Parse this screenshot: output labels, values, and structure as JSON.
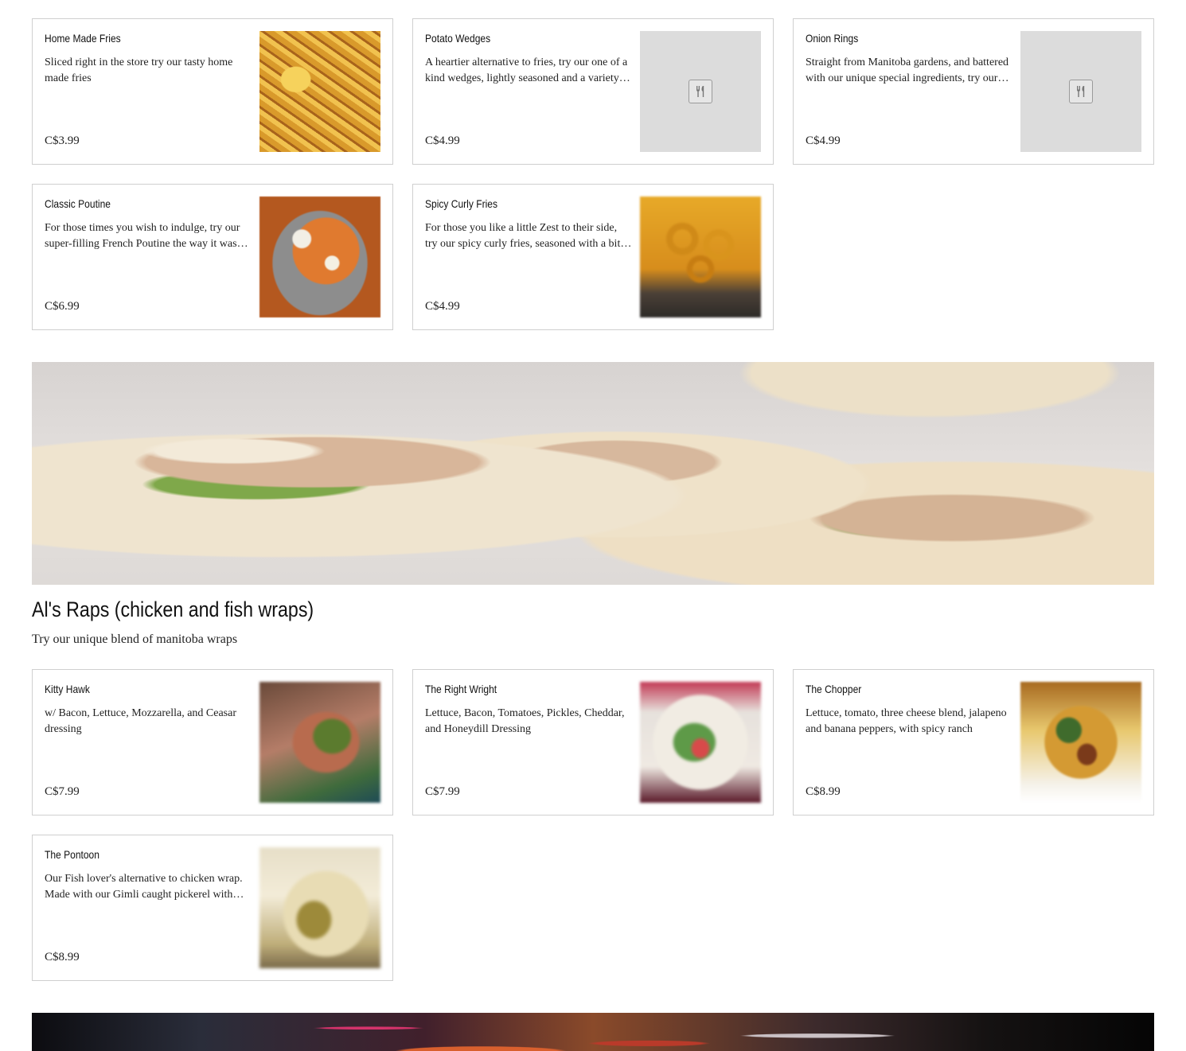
{
  "sides": [
    {
      "name": "Home Made Fries",
      "description": "Sliced right in the store try our tasty home made fries",
      "price": "C$3.99",
      "image": "fries-photo"
    },
    {
      "name": "Potato Wedges",
      "description": "A heartier alternative to fries, try our one of a kind wedges, lightly seasoned and a variety of dipping sauces",
      "price": "C$4.99",
      "image": "placeholder"
    },
    {
      "name": "Onion Rings",
      "description": "Straight from Manitoba gardens, and battered with our unique special ingredients, try our onion rings",
      "price": "C$4.99",
      "image": "placeholder"
    },
    {
      "name": "Classic Poutine",
      "description": "For those times you wish to indulge, try our super-filling French Poutine the way it was meant to be",
      "price": "C$6.99",
      "image": "poutine-photo"
    },
    {
      "name": "Spicy Curly Fries",
      "description": "For those you like a little Zest to their side, try our spicy curly fries, seasoned with a bit of kick",
      "price": "C$4.99",
      "image": "curly-fries-photo"
    }
  ],
  "wraps_section": {
    "title": "Al's Raps (chicken and fish wraps)",
    "description": "Try our unique blend of manitoba wraps"
  },
  "wraps": [
    {
      "name": "Kitty Hawk",
      "description": "w/ Bacon, Lettuce, Mozzarella, and Ceasar dressing",
      "price": "C$7.99",
      "image": "wrap-photo"
    },
    {
      "name": "The Right Wright",
      "description": "Lettuce, Bacon, Tomatoes, Pickles, Cheddar, and Honeydill Dressing",
      "price": "C$7.99",
      "image": "wrap-photo"
    },
    {
      "name": "The Chopper",
      "description": "Lettuce, tomato, three cheese blend, jalapeno and banana peppers, with spicy ranch",
      "price": "C$8.99",
      "image": "wrap-photo"
    },
    {
      "name": "The Pontoon",
      "description": "Our Fish lover's alternative to chicken wrap. Made with our Gimli caught pickerel with tartar sauce",
      "price": "C$8.99",
      "image": "wrap-photo"
    }
  ],
  "icons": {
    "placeholder": "fork-knife-icon"
  },
  "colors": {
    "border": "#cfcfcf",
    "placeholder_bg": "#dcdcdc",
    "text": "#111111"
  }
}
